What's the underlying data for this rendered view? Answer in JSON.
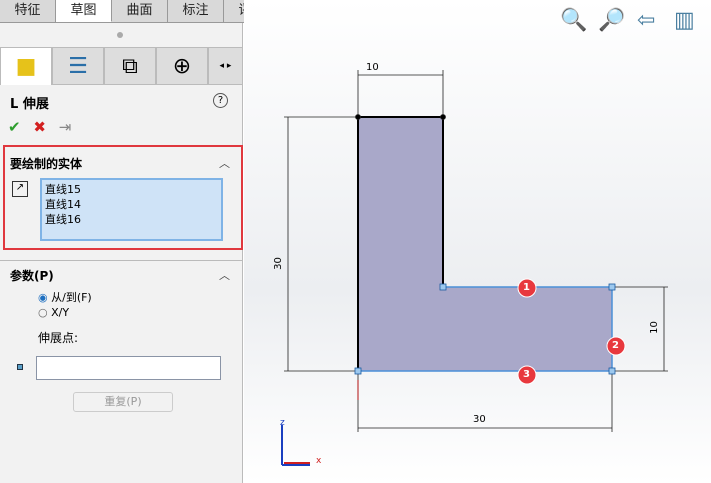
{
  "tabs": [
    "特征",
    "草图",
    "曲面",
    "标注",
    "评估"
  ],
  "active_tab": 1,
  "feature_title": "伸展",
  "section1": {
    "title": "要绘制的实体",
    "items": [
      "直线15",
      "直线14",
      "直线16"
    ]
  },
  "section2": {
    "title": "参数(P)",
    "radio_from_to": "从/到(F)",
    "radio_xy": "X/Y",
    "point_label": "伸展点:",
    "point_value": "",
    "repeat_button": "重复(P)"
  },
  "dimensions": {
    "top": "10",
    "left": "30",
    "right": "10",
    "bottom": "30"
  },
  "markers": [
    "1",
    "2",
    "3"
  ],
  "axes": {
    "z": "z",
    "x": "x"
  }
}
